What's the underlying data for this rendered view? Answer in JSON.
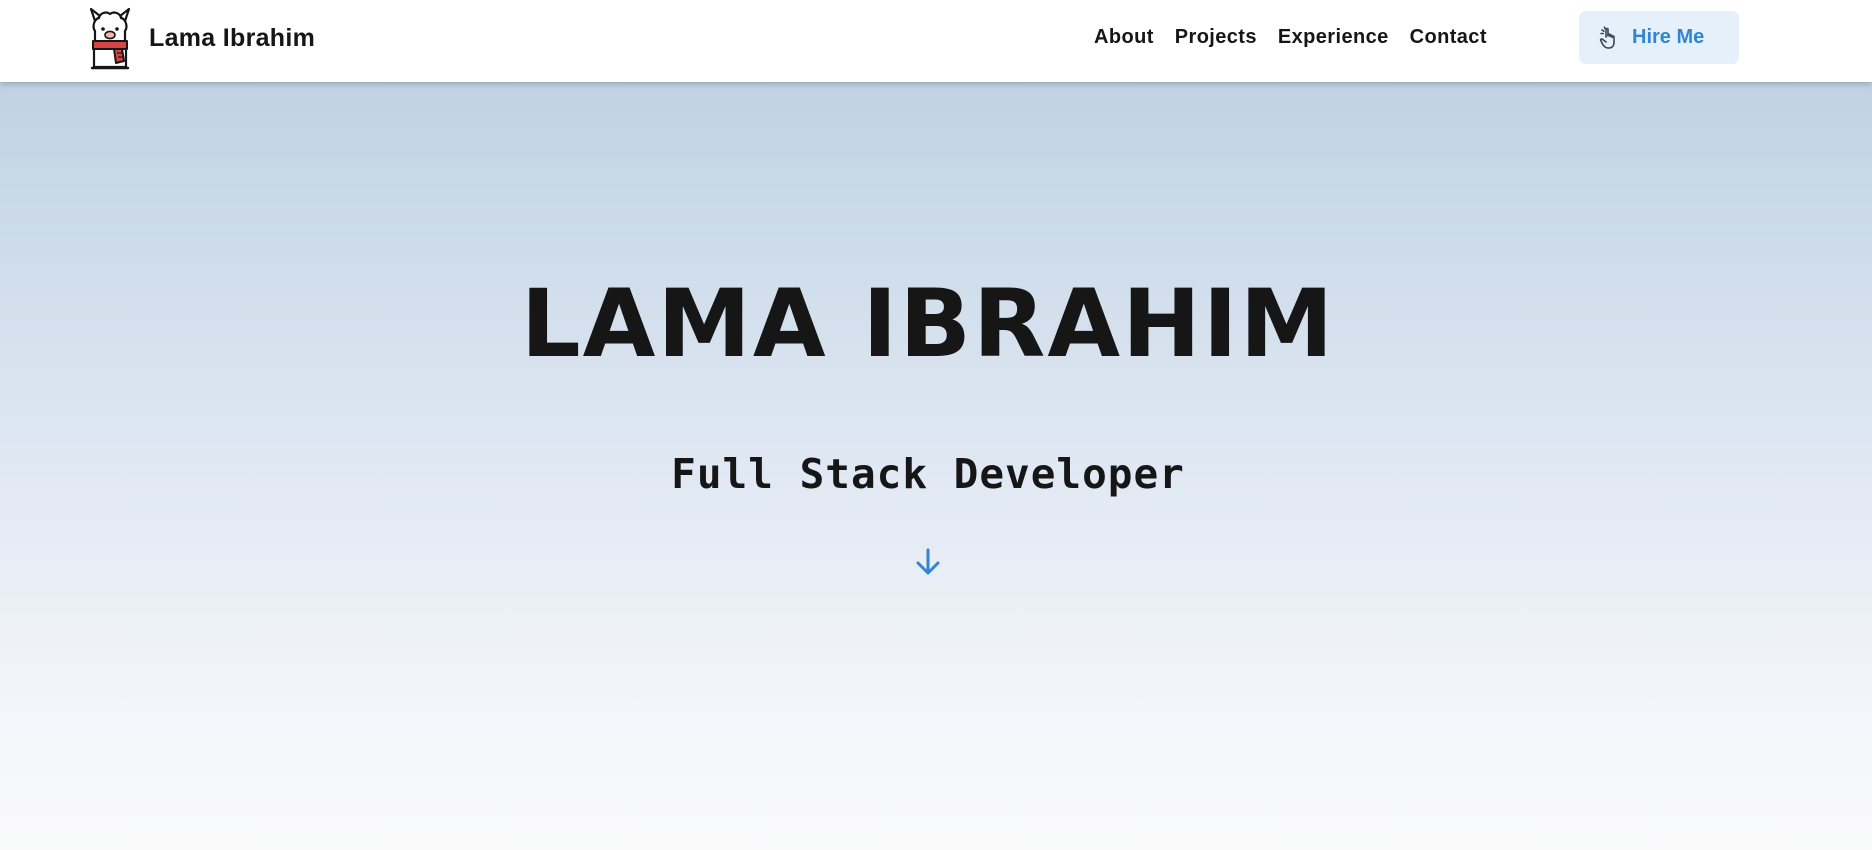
{
  "header": {
    "brand_name": "Lama Ibrahim",
    "logo_icon": "llama-scarf-icon",
    "nav": [
      {
        "label": "About"
      },
      {
        "label": "Projects"
      },
      {
        "label": "Experience"
      },
      {
        "label": "Contact"
      }
    ],
    "cta": {
      "label": "Hire Me",
      "icon": "pointer-hand-icon"
    }
  },
  "hero": {
    "title": "LAMA IBRAHIM",
    "subtitle": "Full Stack Developer",
    "scroll_icon": "arrow-down-icon"
  },
  "colors": {
    "accent": "#2f86d6",
    "cta_background": "#e6f0fa",
    "text": "#161616",
    "scarf": "#d64545",
    "gradient_top": "#b9cde0",
    "gradient_bottom": "#fafafb"
  }
}
